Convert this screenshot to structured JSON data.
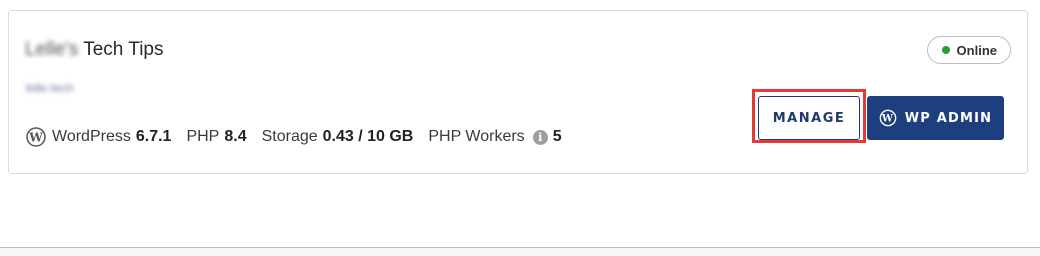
{
  "site": {
    "name_blurred": "Lelle's",
    "name": "Tech Tips",
    "url_blurred": "lelle.tech"
  },
  "status": {
    "label": "Online",
    "color": "#2e9a3a"
  },
  "meta": {
    "wordpress_label": "WordPress",
    "wordpress_version": "6.7.1",
    "php_label": "PHP",
    "php_version": "8.4",
    "storage_label": "Storage",
    "storage_value": "0.43 / 10 GB",
    "workers_label": "PHP Workers",
    "workers_value": "5"
  },
  "actions": {
    "manage_label": "MANAGE",
    "wp_admin_label": "WP ADMIN"
  },
  "colors": {
    "primary": "#1e3f7e",
    "highlight": "#e53935"
  },
  "icons": {
    "wordpress": "wordpress-icon",
    "info": "info-icon",
    "status_dot": "status-dot-icon"
  }
}
